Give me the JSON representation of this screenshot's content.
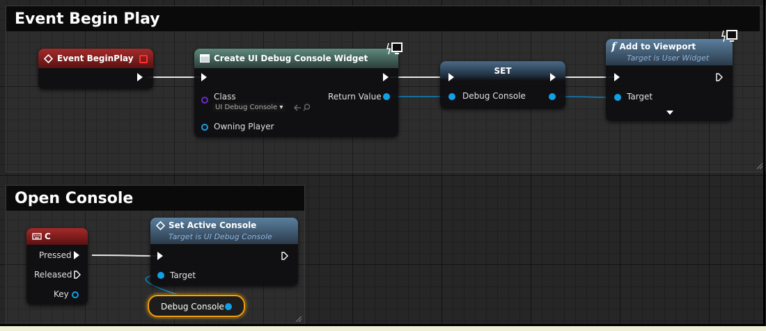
{
  "comments": {
    "begin_play": "Event Begin Play",
    "open_console": "Open Console"
  },
  "nodes": {
    "event_begin_play": {
      "title": "Event BeginPlay"
    },
    "create_widget": {
      "title": "Create UI Debug Console Widget",
      "class_label": "Class",
      "class_value": "UI Debug Console",
      "return_label": "Return Value",
      "owning_label": "Owning Player"
    },
    "set": {
      "title": "SET",
      "pin_label": "Debug Console"
    },
    "add_to_viewport": {
      "title": "Add to Viewport",
      "subtitle": "Target is User Widget",
      "target_label": "Target"
    },
    "key_c": {
      "title": "C",
      "pressed": "Pressed",
      "released": "Released",
      "key": "Key"
    },
    "set_active_console": {
      "title": "Set Active Console",
      "subtitle": "Target is UI Debug Console",
      "target_label": "Target"
    },
    "debug_console_var": {
      "label": "Debug Console"
    }
  },
  "colors": {
    "event_header": "#a52a2a",
    "object_pin": "#11a0e8",
    "class_pin": "#6a2ad0",
    "selection": "#f0a010"
  }
}
